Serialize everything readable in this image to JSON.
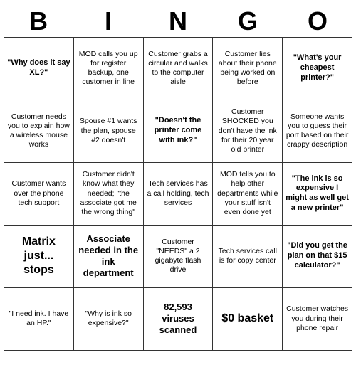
{
  "header": {
    "letters": [
      "B",
      "I",
      "N",
      "G",
      "O"
    ]
  },
  "cells": [
    {
      "text": "\"Why does it say XL?\"",
      "style": "quoted"
    },
    {
      "text": "MOD calls you up for register backup, one customer in line",
      "style": "normal"
    },
    {
      "text": "Customer grabs a circular and walks to the computer aisle",
      "style": "normal"
    },
    {
      "text": "Customer lies about their phone being worked on before",
      "style": "normal"
    },
    {
      "text": "\"What's your cheapest printer?\"",
      "style": "quoted"
    },
    {
      "text": "Customer needs you to explain how a wireless mouse works",
      "style": "normal"
    },
    {
      "text": "Spouse #1 wants the plan, spouse #2 doesn't",
      "style": "normal"
    },
    {
      "text": "\"Doesn't the printer come with ink?\"",
      "style": "quoted"
    },
    {
      "text": "Customer SHOCKED you don't have the ink for their 20 year old printer",
      "style": "normal"
    },
    {
      "text": "Someone wants you to guess their port based on their crappy description",
      "style": "normal"
    },
    {
      "text": "Customer wants over the phone tech support",
      "style": "normal"
    },
    {
      "text": "Customer didn't know what they needed; \"the associate got me the wrong thing\"",
      "style": "normal"
    },
    {
      "text": "Tech services has a call holding, tech services",
      "style": "normal"
    },
    {
      "text": "MOD tells you to help other departments while your stuff isn't even done yet",
      "style": "normal"
    },
    {
      "text": "\"The ink is so expensive I might as well get a new printer\"",
      "style": "quoted"
    },
    {
      "text": "Matrix just... stops",
      "style": "large"
    },
    {
      "text": "Associate needed in the ink department",
      "style": "medium"
    },
    {
      "text": "Customer \"NEEDS\" a 2 gigabyte flash drive",
      "style": "normal"
    },
    {
      "text": "Tech services call is for copy center",
      "style": "normal"
    },
    {
      "text": "\"Did you get the plan on that $15 calculator?\"",
      "style": "quoted"
    },
    {
      "text": "\"I need ink. I have an HP.\"",
      "style": "normal"
    },
    {
      "text": "\"Why is ink so expensive?\"",
      "style": "normal"
    },
    {
      "text": "82,593 viruses scanned",
      "style": "medium"
    },
    {
      "text": "$0 basket",
      "style": "large"
    },
    {
      "text": "Customer watches you during their phone repair",
      "style": "normal"
    }
  ]
}
